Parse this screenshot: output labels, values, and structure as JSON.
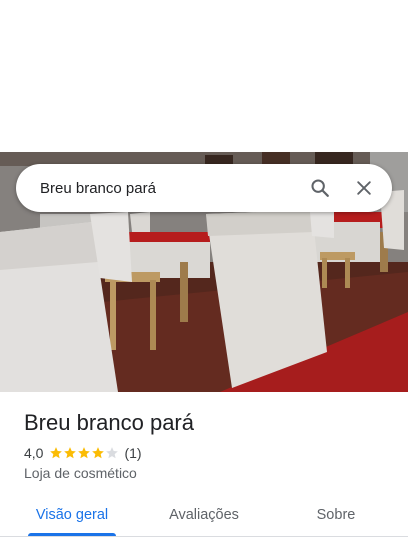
{
  "search": {
    "query": "Breu branco pará",
    "search_icon": "search-icon",
    "close_icon": "close-icon"
  },
  "photo": {
    "subject": "restaurant-interior-photo"
  },
  "place": {
    "name": "Breu branco pará",
    "rating": "4,0",
    "rating_value": 4.0,
    "rating_max": 5,
    "review_count": "(1)",
    "category": "Loja de cosmético"
  },
  "tabs": [
    {
      "label": "Visão geral",
      "active": true
    },
    {
      "label": "Avaliações",
      "active": false
    },
    {
      "label": "Sobre",
      "active": false
    }
  ],
  "colors": {
    "accent": "#1a73e8",
    "star_filled": "#fbbc04",
    "star_empty": "#dadce0",
    "text_primary": "#202124",
    "text_secondary": "#5f6368"
  }
}
